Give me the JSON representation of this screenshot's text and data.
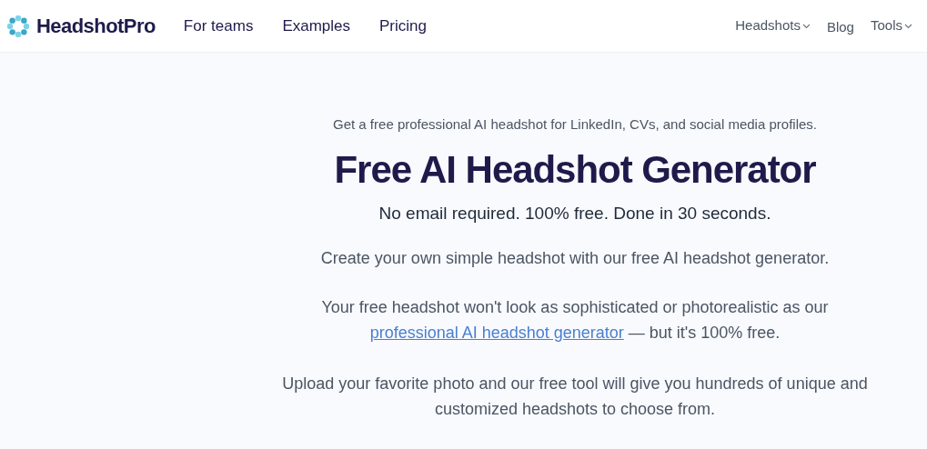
{
  "header": {
    "logo": "HeadshotPro",
    "nav_left": [
      "For teams",
      "Examples",
      "Pricing"
    ],
    "nav_right": [
      {
        "label": "Headshots",
        "kind": "dropdown"
      },
      {
        "label": "Blog",
        "kind": "link"
      },
      {
        "label": "Tools",
        "kind": "dropdown"
      }
    ]
  },
  "hero": {
    "kicker": "Get a free professional AI headshot for LinkedIn, CVs, and social media profiles.",
    "title": "Free AI Headshot Generator",
    "subtitle": "No email required. 100% free. Done in 30 seconds.",
    "intro": "Create your own simple headshot with our free AI headshot generator.",
    "note": {
      "before": "Your free headshot won't look as sophisticated or photorealistic as our",
      "link": "professional AI headshot generator",
      "after": "— but it's 100% free."
    },
    "upload_text": "Upload your favorite photo and our free tool will give you hundreds of unique and customized headshots to choose from."
  }
}
